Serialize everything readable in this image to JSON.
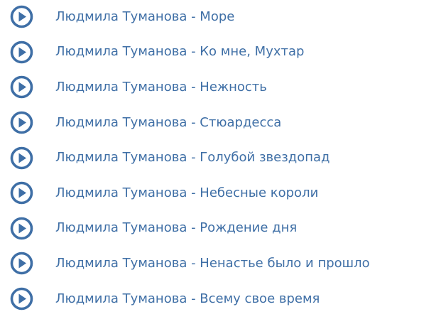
{
  "colors": {
    "accent": "#3f6fa6"
  },
  "icons": {
    "play": "play-circle-icon"
  },
  "tracks": [
    {
      "title": "Людмила Туманова - Море"
    },
    {
      "title": "Людмила Туманова - Ко мне, Мухтар"
    },
    {
      "title": "Людмила Туманова - Нежность"
    },
    {
      "title": "Людмила Туманова - Стюардесса"
    },
    {
      "title": "Людмила Туманова - Голубой звездопад"
    },
    {
      "title": "Людмила Туманова - Небесные короли"
    },
    {
      "title": "Людмила Туманова - Рождение дня"
    },
    {
      "title": "Людмила Туманова - Ненастье было и прошло"
    },
    {
      "title": "Людмила Туманова - Всему свое время"
    }
  ]
}
